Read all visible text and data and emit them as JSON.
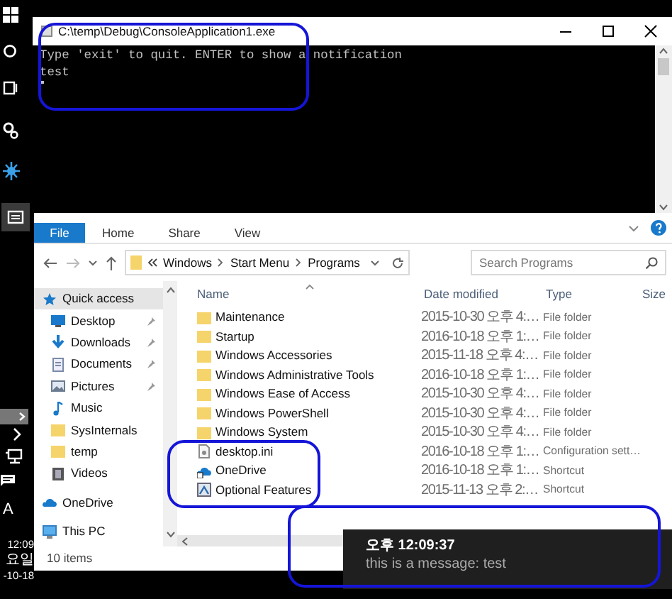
{
  "taskbar": {
    "ime": "A",
    "clock": [
      "12:09",
      "요일",
      "-10-18"
    ]
  },
  "console": {
    "title": "C:\\temp\\Debug\\ConsoleApplication1.exe",
    "lines": [
      "Type 'exit' to quit. ENTER to show a notification",
      "test"
    ]
  },
  "explorer": {
    "ribbon_tabs": [
      {
        "label": "File",
        "kind": "menu"
      },
      {
        "label": "Home",
        "kind": "tab"
      },
      {
        "label": "Share",
        "kind": "tab"
      },
      {
        "label": "View",
        "kind": "tab"
      }
    ],
    "address": {
      "path": [
        "Windows",
        "Start Menu",
        "Programs"
      ],
      "search_placeholder": "Search Programs"
    },
    "nav": {
      "items": [
        {
          "label": "Quick access",
          "kind": "star",
          "selected": true,
          "children": [
            {
              "label": "Desktop",
              "kind": "desktop",
              "selected": false,
              "pinned": true
            },
            {
              "label": "Downloads",
              "kind": "downloads",
              "selected": false,
              "pinned": true
            },
            {
              "label": "Documents",
              "kind": "documents",
              "selected": false,
              "pinned": true
            },
            {
              "label": "Pictures",
              "kind": "pictures",
              "selected": false,
              "pinned": true
            },
            {
              "label": "Music",
              "kind": "music",
              "selected": false,
              "pinned": false
            },
            {
              "label": "SysInternals",
              "kind": "folder",
              "selected": false,
              "pinned": false
            },
            {
              "label": "temp",
              "kind": "folder",
              "selected": false,
              "pinned": false
            },
            {
              "label": "Videos",
              "kind": "videos",
              "selected": false,
              "pinned": false
            }
          ]
        },
        {
          "label": "OneDrive",
          "kind": "cloud",
          "selected": false
        },
        {
          "label": "This PC",
          "kind": "pc",
          "selected": false
        }
      ]
    },
    "columns": [
      "Name",
      "Date modified",
      "Type",
      "Size"
    ],
    "rows": [
      {
        "name": "Maintenance",
        "date": "2015-10-30 오후 4:…",
        "type": "File folder",
        "kind": "folder"
      },
      {
        "name": "Startup",
        "date": "2016-10-18 오후 1:…",
        "type": "File folder",
        "kind": "folder"
      },
      {
        "name": "Windows Accessories",
        "date": "2015-11-18 오후 4:…",
        "type": "File folder",
        "kind": "folder"
      },
      {
        "name": "Windows Administrative Tools",
        "date": "2016-10-18 오후 1:…",
        "type": "File folder",
        "kind": "folder"
      },
      {
        "name": "Windows Ease of Access",
        "date": "2015-10-30 오후 4:…",
        "type": "File folder",
        "kind": "folder"
      },
      {
        "name": "Windows PowerShell",
        "date": "2015-10-30 오후 4:…",
        "type": "File folder",
        "kind": "folder"
      },
      {
        "name": "Windows System",
        "date": "2015-10-30 오후 4:…",
        "type": "File folder",
        "kind": "folder"
      },
      {
        "name": "desktop.ini",
        "date": "2016-10-18 오후 1:…",
        "type": "Configuration sett…",
        "kind": "settings-file"
      },
      {
        "name": "OneDrive",
        "date": "2016-10-18 오후 1:…",
        "type": "Shortcut",
        "kind": "cloud-shortcut"
      },
      {
        "name": "Optional Features",
        "date": "2015-11-13 오후 2:…",
        "type": "Shortcut",
        "kind": "app-shortcut"
      }
    ],
    "status": "10 items"
  },
  "notification": {
    "title": "오후 12:09:37",
    "message": "this is a message: test"
  }
}
